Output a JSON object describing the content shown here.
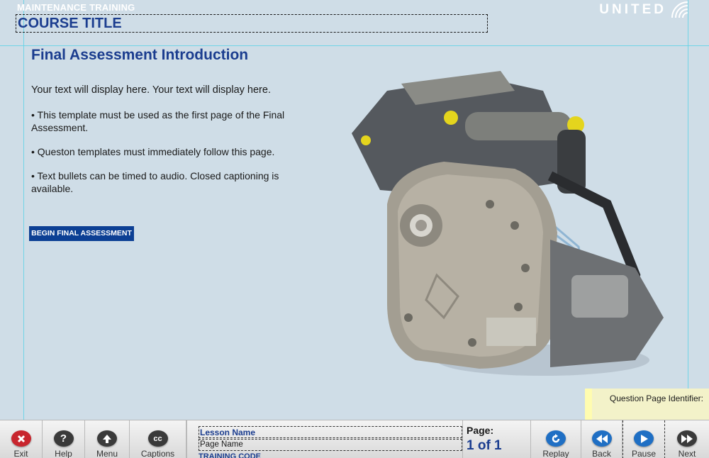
{
  "header": {
    "section_label": "MAINTENANCE TRAINING",
    "course_title": "COURSE TITLE",
    "brand_name": "UNITED",
    "brand_icon": "globe-icon"
  },
  "content": {
    "heading": "Final Assessment Introduction",
    "lead_text": "Your text will display here.  Your text will display here.",
    "bullets": [
      "• This template must be used as the first page of the Final Assessment.",
      "• Queston templates must immediately follow this page.",
      "• Text bullets can be timed to audio.  Closed captioning is available."
    ],
    "begin_button": "BEGIN FINAL ASSESSMENT",
    "image_subject": "aircraft-engine-image"
  },
  "question_page_identifier": "Question Page Identifier:",
  "footer": {
    "buttons_left": [
      {
        "label": "Exit",
        "icon": "close-icon",
        "color": "#c8262e"
      },
      {
        "label": "Help",
        "icon": "question-icon",
        "color": "#3a3a3a"
      },
      {
        "label": "Menu",
        "icon": "arrow-up-icon",
        "color": "#3a3a3a"
      },
      {
        "label": "Captions",
        "icon": "cc-icon",
        "color": "#3a3a3a"
      }
    ],
    "lesson_name": "Lesson Name",
    "page_name": "Page Name",
    "training_code": "TRAINING CODE",
    "page_label": "Page:",
    "page_count": "1 of 1",
    "buttons_right": [
      {
        "label": "Replay",
        "icon": "replay-icon",
        "color": "#1f6fc4"
      },
      {
        "label": "Back",
        "icon": "rewind-icon",
        "color": "#1f6fc4"
      },
      {
        "label": "Pause",
        "icon": "play-icon",
        "color": "#1f6fc4"
      },
      {
        "label": "Next",
        "icon": "fast-forward-icon",
        "color": "#3a3a3a"
      }
    ]
  },
  "colors": {
    "background": "#cfdde7",
    "title_blue": "#1b3d8f",
    "button_blue": "#0c3f94",
    "guide_cyan": "#5fd3e6"
  }
}
